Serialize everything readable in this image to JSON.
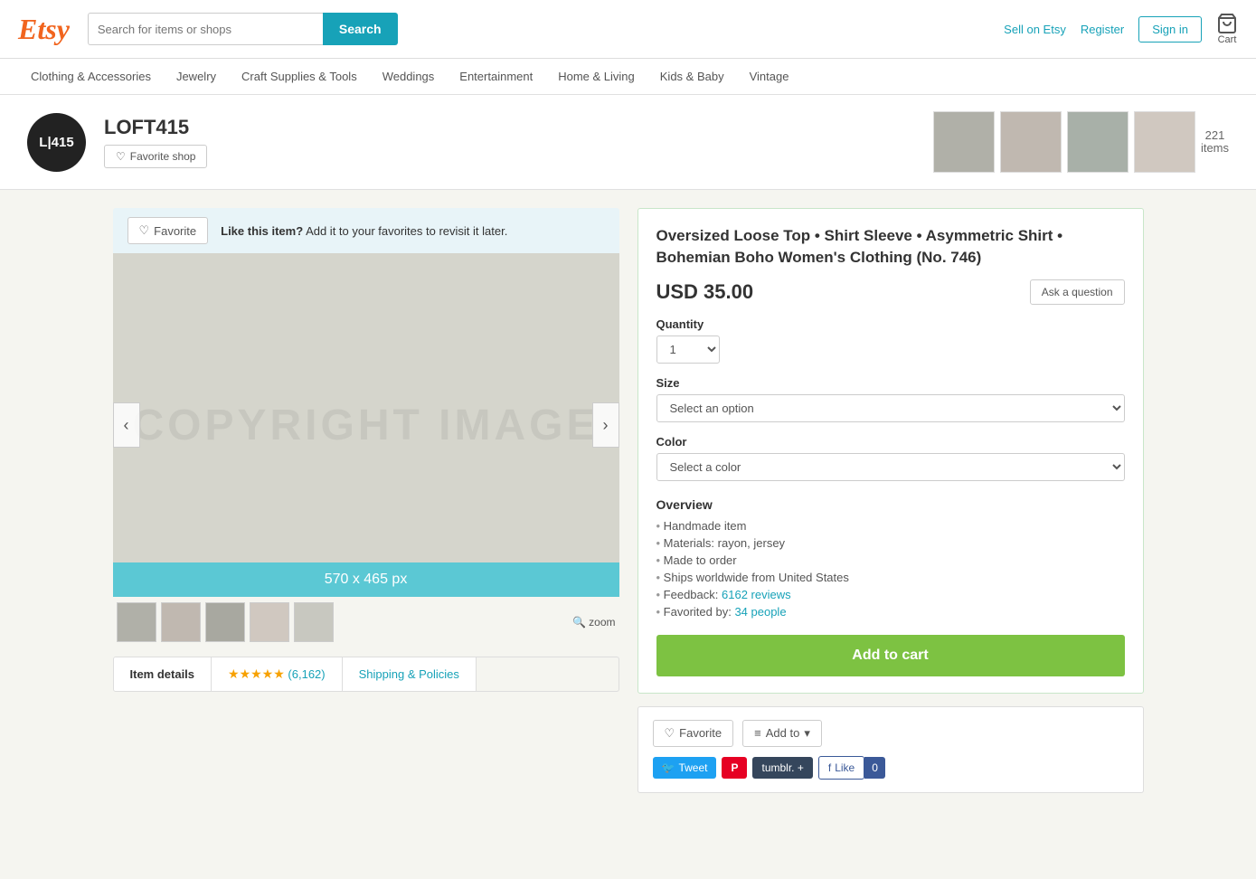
{
  "header": {
    "logo": "Etsy",
    "search_placeholder": "Search for items or shops",
    "search_button": "Search",
    "sell_link": "Sell on Etsy",
    "register_link": "Register",
    "signin_button": "Sign in",
    "cart_label": "Cart"
  },
  "nav": {
    "items": [
      {
        "label": "Clothing & Accessories"
      },
      {
        "label": "Jewelry"
      },
      {
        "label": "Craft Supplies & Tools"
      },
      {
        "label": "Weddings"
      },
      {
        "label": "Entertainment"
      },
      {
        "label": "Home & Living"
      },
      {
        "label": "Kids & Baby"
      },
      {
        "label": "Vintage"
      }
    ]
  },
  "shop": {
    "logo_text": "L|415",
    "name": "LOFT415",
    "favorite_shop": "Favorite shop",
    "item_count": "221",
    "item_label": "items"
  },
  "product": {
    "title": "Oversized Loose Top • Shirt Sleeve • Asymmetric Shirt • Bohemian Boho Women's Clothing (No. 746)",
    "price": "USD 35.00",
    "ask_question": "Ask a question",
    "quantity_label": "Quantity",
    "quantity_default": "1",
    "size_label": "Size",
    "size_placeholder": "Select an option",
    "color_label": "Color",
    "color_placeholder": "Select a color",
    "overview_title": "Overview",
    "overview_items": [
      "Handmade item",
      "Materials: rayon, jersey",
      "Made to order",
      "Ships worldwide from United States",
      "Feedback: 6162 reviews",
      "Favorited by: 34 people"
    ],
    "feedback_link": "6162 reviews",
    "favorited_link": "34 people",
    "add_to_cart": "Add to cart"
  },
  "favorite_bar": {
    "button": "Favorite",
    "text_bold": "Like this item?",
    "text_sub": "Add it to your favorites to revisit it later."
  },
  "image": {
    "size_label": "570 x 465 px",
    "watermark": "COPYRIGHT IMAGE",
    "zoom": "zoom"
  },
  "tabs": {
    "item_details": "Item details",
    "stars": "★★★★★",
    "review_count": "(6,162)",
    "shipping": "Shipping & Policies"
  },
  "social": {
    "favorite_btn": "Favorite",
    "add_to_btn": "Add to",
    "tweet": "Tweet",
    "pinterest": "P",
    "tumblr": "tumblr. +",
    "fb_like": "Like",
    "fb_count": "0"
  }
}
